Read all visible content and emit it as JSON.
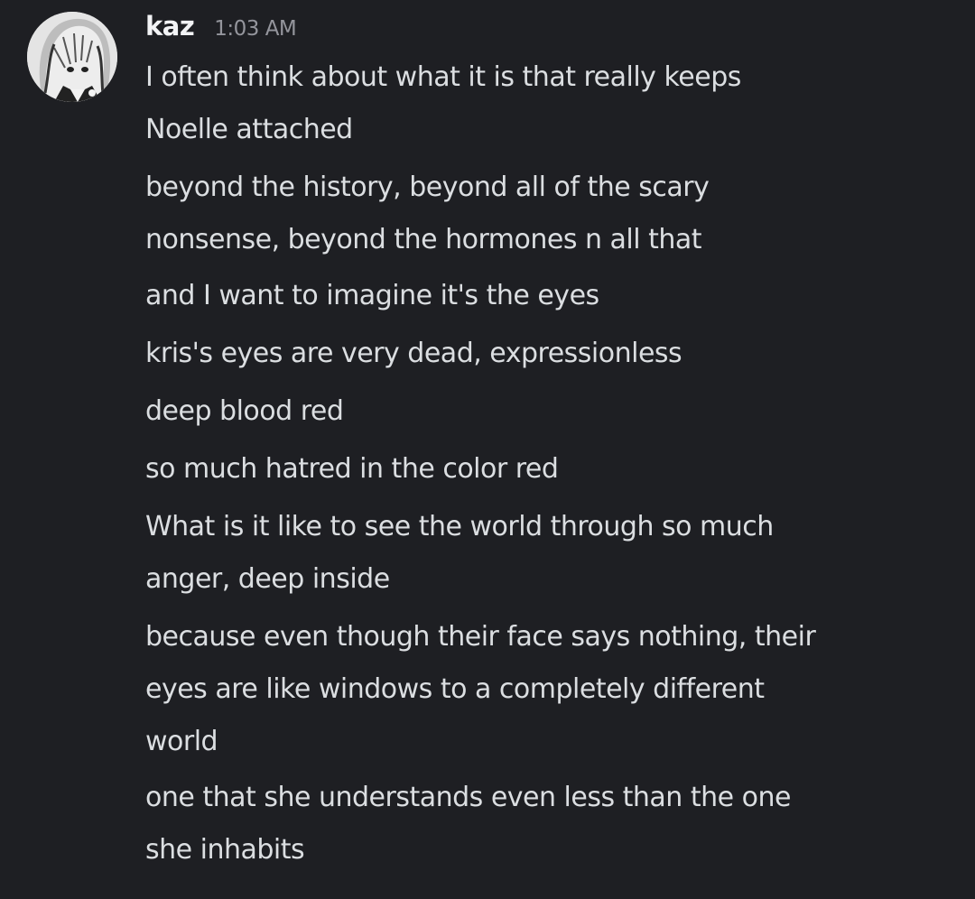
{
  "author": {
    "username": "kaz",
    "timestamp": "1:03 AM",
    "avatar_icon": "manga-girl-avatar-icon"
  },
  "messages": [
    {
      "lines": [
        "I often think about what it is that really keeps",
        "Noelle attached"
      ]
    },
    {
      "lines": [
        "beyond the history, beyond all of the scary",
        "nonsense, beyond the hormones n all that"
      ]
    },
    {
      "lines": [
        "and I want to imagine it's the eyes"
      ]
    },
    {
      "lines": [
        "kris's eyes are very dead, expressionless"
      ]
    },
    {
      "lines": [
        "deep blood red"
      ]
    },
    {
      "lines": [
        "so much hatred in the color red"
      ]
    },
    {
      "lines": [
        "What is it like to see the world through so much",
        "anger, deep inside"
      ]
    },
    {
      "lines": [
        "because even though their face says nothing, their",
        "eyes are like windows to a completely different",
        "world"
      ]
    },
    {
      "lines": [
        "one that she understands even less than the one",
        "she inhabits"
      ]
    }
  ],
  "colors": {
    "background": "#1e1f23",
    "username": "#f2f3f5",
    "timestamp": "#94959c",
    "message_text": "#dbdee1"
  }
}
